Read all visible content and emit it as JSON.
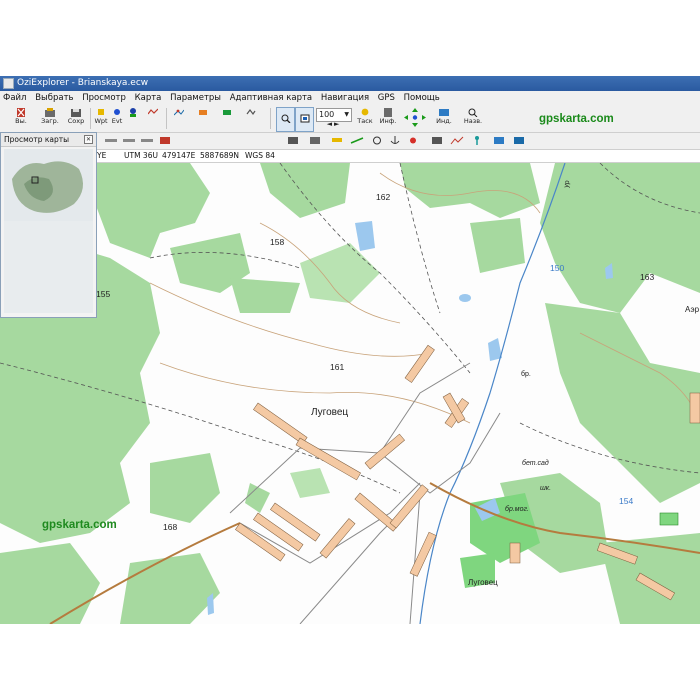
{
  "window": {
    "title": "OziExplorer - Brianskaya.ecw"
  },
  "menu": [
    "Файл",
    "Выбрать",
    "Просмотр",
    "Карта",
    "Параметры",
    "Адаптивная карта",
    "Навигация",
    "GPS",
    "Помощь"
  ],
  "toolbar": {
    "buttons": [
      {
        "label": "Вы.",
        "icon": "exit-icon"
      },
      {
        "label": "Загр.",
        "icon": "load-icon"
      },
      {
        "label": "Сохр",
        "icon": "save-icon"
      },
      {
        "label": "Wpt",
        "icon": "waypoint-icon"
      },
      {
        "label": "Evt",
        "icon": "event-icon"
      },
      {
        "label": "",
        "icon": "track-icon"
      },
      {
        "label": "Таск",
        "icon": "task-icon"
      },
      {
        "label": "Инф.",
        "icon": "info-icon"
      },
      {
        "label": "Инд.",
        "icon": "indicator-icon"
      },
      {
        "label": "Назв.",
        "icon": "names-icon"
      }
    ],
    "zoom_value": "100",
    "brand": "gpskarta.com"
  },
  "status": {
    "zone_suffix": "YE",
    "utm": "UTM 36U",
    "easting": "479147E",
    "northing": "5887689N",
    "datum": "WGS 84"
  },
  "overview": {
    "title": "Просмотр карты",
    "close": "✕"
  },
  "map": {
    "labels": {
      "village": "Луговец",
      "village_bottom": "Луговец",
      "h162": "162",
      "h158": "158",
      "h155": "155",
      "h161": "161",
      "h168": "168",
      "h163": "163",
      "h150": "150",
      "h154": "154",
      "br": "бр.",
      "bet_sad": "бет.сад",
      "shk": "шк.",
      "br_mog": "бр.мог.",
      "ur": "ур",
      "aer": "Аэр"
    },
    "watermark": "gpskarta.com"
  }
}
